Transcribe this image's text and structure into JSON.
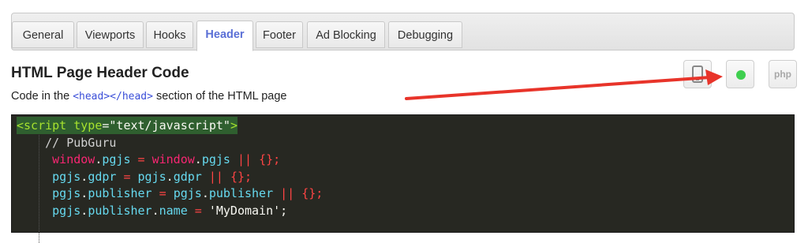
{
  "tabs": [
    {
      "label": "General",
      "active": false
    },
    {
      "label": "Viewports",
      "active": false
    },
    {
      "label": "Hooks",
      "active": false
    },
    {
      "label": "Header",
      "active": true
    },
    {
      "label": "Footer",
      "active": false
    },
    {
      "label": "Ad Blocking",
      "active": false
    },
    {
      "label": "Debugging",
      "active": false
    }
  ],
  "header": {
    "title": "HTML Page Header Code",
    "subtitle_before": "Code in the ",
    "subtitle_code": "<head></head>",
    "subtitle_after": " section of the HTML page"
  },
  "tools": {
    "mobile_icon": "mobile-phone-icon",
    "status_icon": "green-dot-icon",
    "status_color": "#3fcf4f",
    "php_label": "php"
  },
  "annotation": {
    "arrow_color": "#e8342a"
  },
  "editor": {
    "lines": [
      {
        "tokens": [
          [
            "tag",
            "<script "
          ],
          [
            "attr",
            "type"
          ],
          [
            "white",
            "="
          ],
          [
            "strw",
            "\"text/javascript\""
          ],
          [
            "tag",
            ">"
          ]
        ]
      },
      {
        "tokens": [
          [
            "cm",
            "    // PubGuru"
          ]
        ]
      },
      {
        "tokens": [
          [
            "pink",
            "     window"
          ],
          [
            "white",
            "."
          ],
          [
            "cyan",
            "pgjs"
          ],
          [
            "white",
            " "
          ],
          [
            "red",
            "="
          ],
          [
            "white",
            " "
          ],
          [
            "pink",
            "window"
          ],
          [
            "white",
            "."
          ],
          [
            "cyan",
            "pgjs"
          ],
          [
            "white",
            " "
          ],
          [
            "red",
            "||"
          ],
          [
            "white",
            " "
          ],
          [
            "red",
            "{};"
          ]
        ]
      },
      {
        "tokens": [
          [
            "cyan",
            "     pgjs"
          ],
          [
            "white",
            "."
          ],
          [
            "cyan",
            "gdpr"
          ],
          [
            "white",
            " "
          ],
          [
            "red",
            "="
          ],
          [
            "white",
            " "
          ],
          [
            "cyan",
            "pgjs"
          ],
          [
            "white",
            "."
          ],
          [
            "cyan",
            "gdpr"
          ],
          [
            "white",
            " "
          ],
          [
            "red",
            "||"
          ],
          [
            "white",
            " "
          ],
          [
            "red",
            "{};"
          ]
        ]
      },
      {
        "tokens": [
          [
            "cyan",
            "     pgjs"
          ],
          [
            "white",
            "."
          ],
          [
            "cyan",
            "publisher"
          ],
          [
            "white",
            " "
          ],
          [
            "red",
            "="
          ],
          [
            "white",
            " "
          ],
          [
            "cyan",
            "pgjs"
          ],
          [
            "white",
            "."
          ],
          [
            "cyan",
            "publisher"
          ],
          [
            "white",
            " "
          ],
          [
            "red",
            "||"
          ],
          [
            "white",
            " "
          ],
          [
            "red",
            "{};"
          ]
        ]
      },
      {
        "tokens": [
          [
            "cyan",
            "     pgjs"
          ],
          [
            "white",
            "."
          ],
          [
            "cyan",
            "publisher"
          ],
          [
            "white",
            "."
          ],
          [
            "cyan",
            "name"
          ],
          [
            "white",
            " "
          ],
          [
            "red",
            "="
          ],
          [
            "white",
            " "
          ],
          [
            "strw",
            "'MyDomain'"
          ],
          [
            "white",
            ";"
          ]
        ]
      }
    ]
  }
}
